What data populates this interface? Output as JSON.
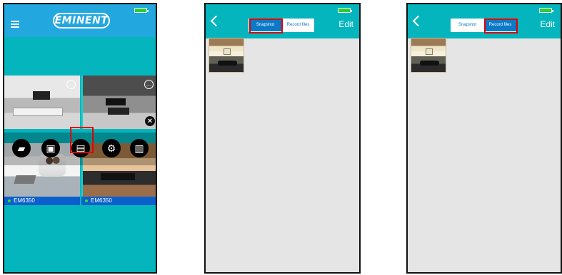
{
  "phone1": {
    "logo": "EMINENT",
    "camera_labels": [
      "EM6350",
      "EM6350"
    ],
    "more_symbol": "…",
    "close_symbol": "×",
    "action_icons": [
      "camera-icon",
      "sd-card-icon",
      "snapshot-folder-icon",
      "gear-icon",
      "trash-icon"
    ]
  },
  "phone2": {
    "segments": [
      "Snapshot",
      "Record files"
    ],
    "active_segment": "Snapshot",
    "edit_label": "Edit"
  },
  "phone3": {
    "segments": [
      "Snapshot",
      "Record files"
    ],
    "active_segment": "Record files",
    "edit_label": "Edit"
  },
  "colors": {
    "app_teal": "#05b5bd",
    "header_blue": "#22a7df",
    "segment_blue": "#0b78c8",
    "highlight_red": "#e00000"
  }
}
